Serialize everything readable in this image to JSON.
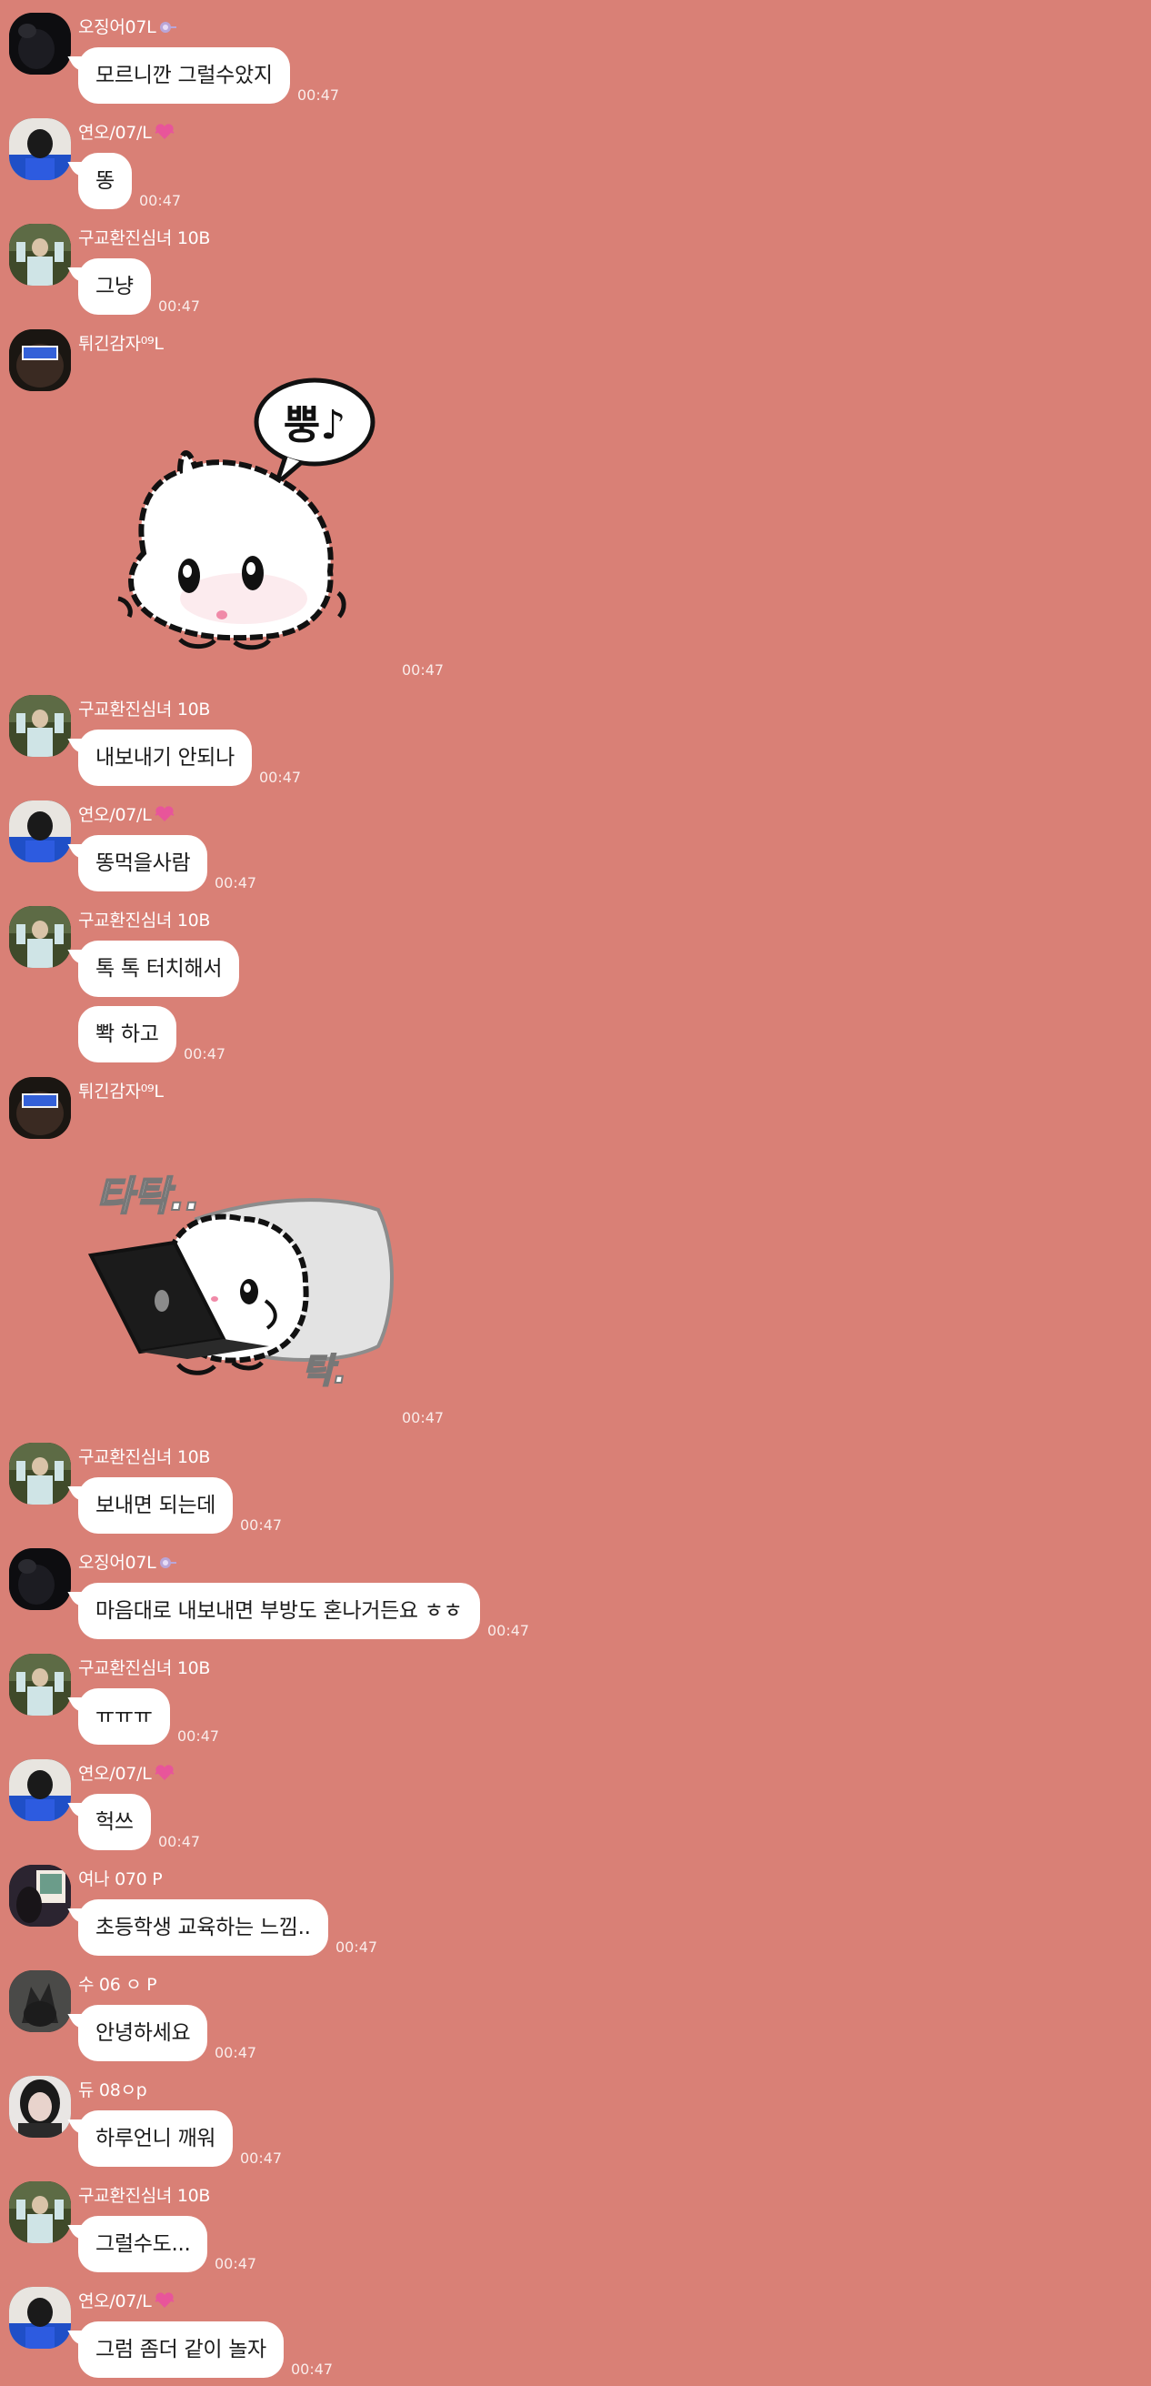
{
  "colors": {
    "background": "#D98076",
    "bubble": "#FFFFFF",
    "meta_text": "#FFFFFF"
  },
  "messages": [
    {
      "sender": "오징어07L",
      "badge": "lollipop-icon",
      "text": "모르니깐 그럴수았지",
      "time": "00:47"
    },
    {
      "sender": "연오/07/L",
      "badge": "heart-icon",
      "text": "똥",
      "time": "00:47"
    },
    {
      "sender": "구교환진심녀 10B",
      "text": "그냥",
      "time": "00:47"
    },
    {
      "sender": "튀긴감자⁰⁹L",
      "sticker": "cat-speech-sticker",
      "sticker_text": "뿡♪",
      "time": "00:47"
    },
    {
      "sender": "구교환진심녀 10B",
      "text": "내보내기 안되나",
      "time": "00:47"
    },
    {
      "sender": "연오/07/L",
      "badge": "heart-icon",
      "text": "똥먹을사람",
      "time": "00:47"
    },
    {
      "sender": "구교환진심녀 10B",
      "text": "톡 톡 터치해서",
      "text2": "뽝 하고",
      "time": "00:47"
    },
    {
      "sender": "튀긴감자⁰⁹L",
      "sticker": "cat-laptop-sticker",
      "sticker_text": "타탁..",
      "sticker_text2": "탁.",
      "time": "00:47"
    },
    {
      "sender": "구교환진심녀 10B",
      "text": "보내면 되는데",
      "time": "00:47"
    },
    {
      "sender": "오징어07L",
      "badge": "lollipop-icon",
      "text": "마음대로 내보내면 부방도 혼나거든요 ㅎㅎ",
      "time": "00:47"
    },
    {
      "sender": "구교환진심녀 10B",
      "text": "ㅠㅠㅠ",
      "time": "00:47"
    },
    {
      "sender": "연오/07/L",
      "badge": "heart-icon",
      "text": "헉쓰",
      "time": "00:47"
    },
    {
      "sender": "여나 070 P",
      "text": "초등학생 교육하는 느낌..",
      "time": "00:47"
    },
    {
      "sender": "수 06 ㅇ P",
      "text": "안녕하세요",
      "time": "00:47"
    },
    {
      "sender": "듀 08ㅇp",
      "text": "하루언니 깨워",
      "time": "00:47"
    },
    {
      "sender": "구교환진심녀 10B",
      "text": "그럴수도...",
      "time": "00:47"
    },
    {
      "sender": "연오/07/L",
      "badge": "heart-icon",
      "text": "그럼 좀더 같이 놀자",
      "time": "00:47"
    }
  ]
}
